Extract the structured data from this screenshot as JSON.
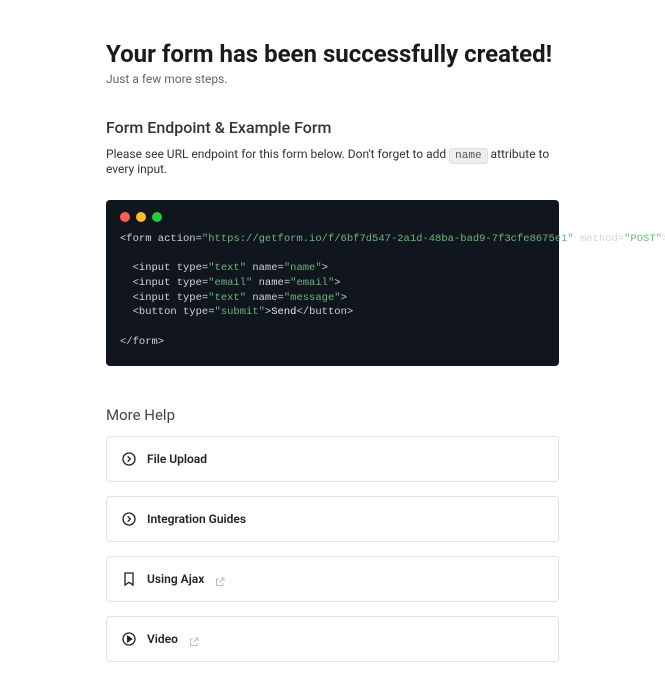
{
  "header": {
    "title": "Your form has been successfully created!",
    "subtitle": "Just a few more steps."
  },
  "endpoint_section": {
    "heading": "Form Endpoint & Example Form",
    "description_pre": "Please see URL endpoint for this form below. Don't forget to add ",
    "chip": "name",
    "description_post": " attribute to every input."
  },
  "code": {
    "l1_a": "<form action=",
    "l1_url": "\"https://getform.io/f/6bf7d547-2a1d-48ba-bad9-7f3cfe8675e1\"",
    "l1_b": " method=",
    "l1_method": "\"POST\"",
    "l1_c": ">",
    "l2_a": "  <input type=",
    "l2_type": "\"text\"",
    "l2_b": " name=",
    "l2_name": "\"name\"",
    "l2_c": ">",
    "l3_a": "  <input type=",
    "l3_type": "\"email\"",
    "l3_b": " name=",
    "l3_name": "\"email\"",
    "l3_c": ">",
    "l4_a": "  <input type=",
    "l4_type": "\"text\"",
    "l4_b": " name=",
    "l4_name": "\"message\"",
    "l4_c": ">",
    "l5_a": "  <button type=",
    "l5_type": "\"submit\"",
    "l5_b": ">",
    "l5_text": "Send",
    "l5_c": "</button>",
    "l6": "</form>"
  },
  "more_help": {
    "heading": "More Help",
    "items": [
      {
        "label": "File Upload",
        "icon": "chevron-circle",
        "external": false
      },
      {
        "label": "Integration Guides",
        "icon": "chevron-circle",
        "external": false
      },
      {
        "label": "Using Ajax",
        "icon": "bookmark",
        "external": true
      },
      {
        "label": "Video",
        "icon": "play-circle",
        "external": true
      }
    ]
  }
}
